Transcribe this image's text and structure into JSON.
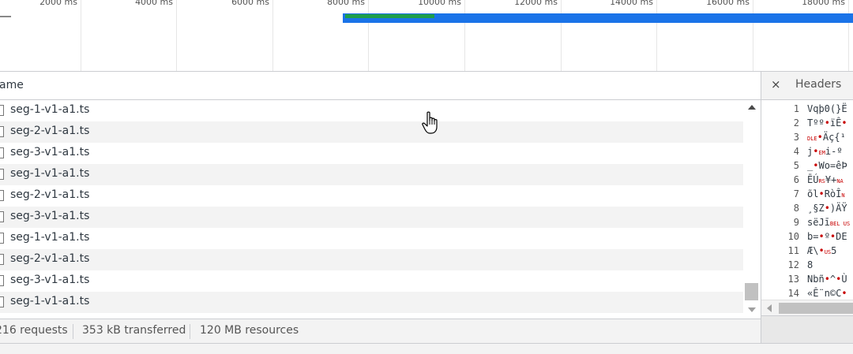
{
  "overview": {
    "ticks": [
      "2000 ms",
      "4000 ms",
      "6000 ms",
      "8000 ms",
      "10000 ms",
      "12000 ms",
      "14000 ms",
      "16000 ms",
      "18000 ms"
    ]
  },
  "table": {
    "column_name": "ame",
    "rows": [
      "seg-1-v1-a1.ts",
      "seg-2-v1-a1.ts",
      "seg-3-v1-a1.ts",
      "seg-1-v1-a1.ts",
      "seg-2-v1-a1.ts",
      "seg-3-v1-a1.ts",
      "seg-1-v1-a1.ts",
      "seg-2-v1-a1.ts",
      "seg-3-v1-a1.ts",
      "seg-1-v1-a1.ts"
    ]
  },
  "status": {
    "requests": "216 requests",
    "transferred": "353 kB transferred",
    "resources": "120 MB resources"
  },
  "details": {
    "close_label": "×",
    "tab_headers": "Headers",
    "line_numbers": [
      "1",
      "2",
      "3",
      "4",
      "5",
      "6",
      "7",
      "8",
      "9",
      "10",
      "11",
      "12",
      "13",
      "14"
    ]
  },
  "colors": {
    "waterfall_bar": "#1a73e8",
    "waterfall_receive": "#1e9e4b"
  }
}
